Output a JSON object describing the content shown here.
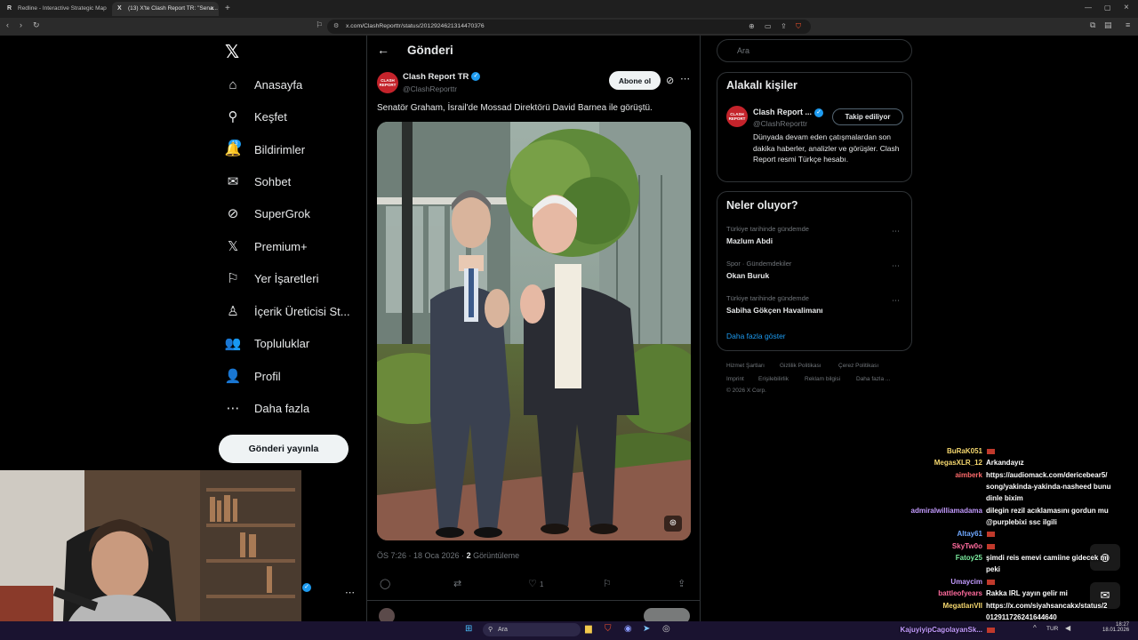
{
  "browser": {
    "tabs": [
      {
        "label": "Redline - Interactive Strategic Map",
        "favicon": "R"
      },
      {
        "label": "(13) X'te Clash Report TR: \"Sena...",
        "favicon": "X"
      }
    ],
    "url": "x.com/ClashReporttr/status/2012924621314470376"
  },
  "sidebar": {
    "items": [
      {
        "label": "Anasayfa",
        "icon": "home-icon",
        "glyph": "⌂"
      },
      {
        "label": "Keşfet",
        "icon": "search-icon",
        "glyph": "⚲"
      },
      {
        "label": "Bildirimler",
        "icon": "bell-icon",
        "glyph": "🔔"
      },
      {
        "label": "Sohbet",
        "icon": "mail-icon",
        "glyph": "✉"
      },
      {
        "label": "SuperGrok",
        "icon": "grok-icon",
        "glyph": "⊘"
      },
      {
        "label": "Premium+",
        "icon": "x-premium-icon",
        "glyph": "𝕏"
      },
      {
        "label": "Yer İşaretleri",
        "icon": "bookmark-icon",
        "glyph": "⚐"
      },
      {
        "label": "İçerik Üreticisi St...",
        "icon": "creator-studio-icon",
        "glyph": "♙"
      },
      {
        "label": "Topluluklar",
        "icon": "communities-icon",
        "glyph": "👥"
      },
      {
        "label": "Profil",
        "icon": "profile-icon",
        "glyph": "👤"
      },
      {
        "label": "Daha fazla",
        "icon": "more-icon",
        "glyph": "⋯"
      }
    ],
    "notification_count": "13",
    "post_button": "Gönderi yayınla"
  },
  "post": {
    "header_title": "Gönderi",
    "author_name": "Clash Report TR",
    "author_handle": "@ClashReporttr",
    "subscribe_label": "Abone ol",
    "text": "Senatör Graham, İsrail'de Mossad Direktörü David Barnea ile görüştü.",
    "time": "ÖS 7:26 · 18 Oca 2026 · ",
    "views_count": "2",
    "views_label": " Görüntüleme",
    "likes": "1"
  },
  "right": {
    "search_placeholder": "Ara",
    "related_title": "Alakalı kişiler",
    "related": {
      "name": "Clash Report ...",
      "handle": "@ClashReporttr",
      "follow_label": "Takip ediliyor",
      "bio": "Dünyada devam eden çatışmalardan son dakika haberler, analizler ve görüşler. Clash Report resmi Türkçe hesabı."
    },
    "trends_title": "Neler oluyor?",
    "trends": [
      {
        "context": "Türkiye tarihinde gündemde",
        "name": "Mazlum Abdi"
      },
      {
        "context": "Spor · Gündemdekiler",
        "name": "Okan Buruk"
      },
      {
        "context": "Türkiye tarihinde gündemde",
        "name": "Sabiha Gökçen Havalimanı"
      }
    ],
    "show_more": "Daha fazla göster",
    "footer": [
      "Hizmet Şartları",
      "Gizlilik Politikası",
      "Çerez Politikası",
      "Imprint",
      "Erişilebilirlik",
      "Reklam bilgisi",
      "Daha fazla ...",
      "© 2026 X Corp."
    ]
  },
  "chat": [
    {
      "user": "BuRaK051",
      "msg": "",
      "color": "#f5d76e"
    },
    {
      "user": "MegasXLR_12",
      "msg": "Arkandayız",
      "color": "#f5d76e"
    },
    {
      "user": "aimberk",
      "msg": "https://audiomack.com/dericebear5/",
      "color": "#ff6b6b"
    },
    {
      "user": "",
      "msg": "song/yakinda-yakinda-nasheed bunu",
      "color": "#fff"
    },
    {
      "user": "",
      "msg": "dinle bixim",
      "color": "#fff"
    },
    {
      "user": "admiralwilliamadama",
      "msg": "dilegin rezil acıklamasını gordun mu",
      "color": "#c39bff"
    },
    {
      "user": "",
      "msg": "@purplebixi ssc ilgili",
      "color": "#fff"
    },
    {
      "user": "Altay61",
      "msg": "",
      "color": "#6fa8ff"
    },
    {
      "user": "SkyTw0o",
      "msg": "",
      "color": "#ff6b9d"
    },
    {
      "user": "Fatoy25",
      "msg": "şimdi reis emevi camiine gidecek mi",
      "color": "#7bed9f"
    },
    {
      "user": "",
      "msg": "peki",
      "color": "#fff"
    },
    {
      "user": "Umaycim",
      "msg": "",
      "color": "#c39bff"
    },
    {
      "user": "battleofyears",
      "msg": "Rakka IRL yayın gelir mi",
      "color": "#ff6b9d"
    },
    {
      "user": "MegatlanVII",
      "msg": "https://x.com/siyahsancakx/status/2",
      "color": "#f5d76e"
    },
    {
      "user": "",
      "msg": "012911726241644640",
      "color": "#fff"
    },
    {
      "user": "KajuyiyipCagolayanSk...",
      "msg": "",
      "color": "#c39bff"
    }
  ],
  "taskbar": {
    "search_placeholder": "Ara",
    "lang": "TUR",
    "time": "18:27",
    "date": "18.01.2026"
  }
}
